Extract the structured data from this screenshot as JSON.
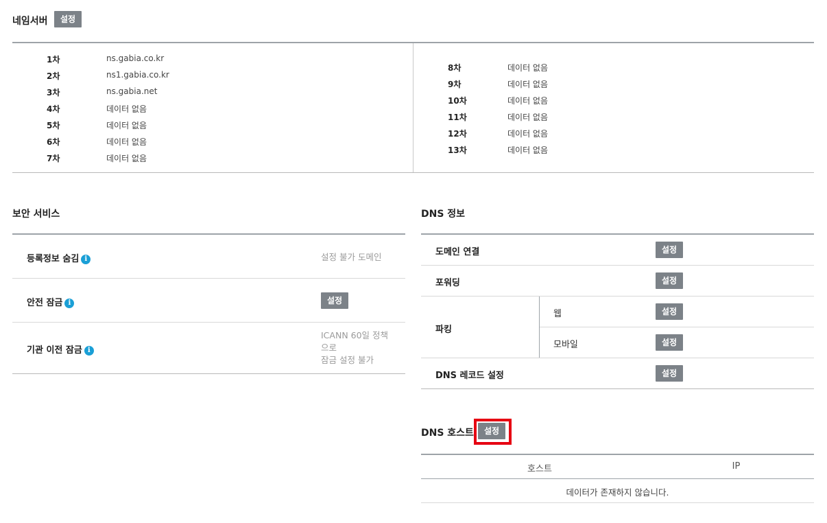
{
  "nameserver": {
    "title": "네임서버",
    "setting_label": "설정",
    "left": [
      {
        "num": "1차",
        "value": "ns.gabia.co.kr"
      },
      {
        "num": "2차",
        "value": "ns1.gabia.co.kr"
      },
      {
        "num": "3차",
        "value": "ns.gabia.net"
      },
      {
        "num": "4차",
        "value": "데이터 없음"
      },
      {
        "num": "5차",
        "value": "데이터 없음"
      },
      {
        "num": "6차",
        "value": "데이터 없음"
      },
      {
        "num": "7차",
        "value": "데이터 없음"
      }
    ],
    "right": [
      {
        "num": "8차",
        "value": "데이터 없음"
      },
      {
        "num": "9차",
        "value": "데이터 없음"
      },
      {
        "num": "10차",
        "value": "데이터 없음"
      },
      {
        "num": "11차",
        "value": "데이터 없음"
      },
      {
        "num": "12차",
        "value": "데이터 없음"
      },
      {
        "num": "13차",
        "value": "데이터 없음"
      }
    ]
  },
  "security": {
    "title": "보안 서비스",
    "rows": [
      {
        "label": "등록정보 숨김",
        "status": "설정 불가 도메인"
      },
      {
        "label": "안전 잠금",
        "button": "설정"
      },
      {
        "label": "기관 이전 잠금",
        "status_line1": "ICANN 60일 정책",
        "status_line2": "으로",
        "status_line3": "잠금 설정 불가"
      }
    ]
  },
  "dns_info": {
    "title": "DNS 정보",
    "domain_connect": {
      "label": "도메인 연결",
      "button": "설정"
    },
    "forwarding": {
      "label": "포워딩",
      "button": "설정"
    },
    "parking": {
      "label": "파킹",
      "web_label": "웹",
      "web_button": "설정",
      "mobile_label": "모바일",
      "mobile_button": "설정"
    },
    "dns_record": {
      "label": "DNS 레코드 설정",
      "button": "설정"
    }
  },
  "dns_host": {
    "title": "DNS 호스트",
    "setting_label": "설정",
    "columns": [
      "호스트",
      "IP"
    ],
    "empty_message": "데이터가 존재하지 않습니다."
  },
  "colors": {
    "button_bg": "#7c8288",
    "info_icon": "#1a9fd6",
    "highlight_border": "#e60012"
  },
  "icons": [
    "info-icon"
  ]
}
